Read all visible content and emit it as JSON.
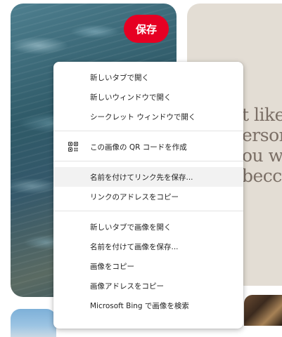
{
  "pin": {
    "save_label": "保存",
    "quote_lines": [
      "t like",
      "ersor",
      "ou wa",
      "becc"
    ]
  },
  "context_menu": {
    "groups": [
      [
        "新しいタブで開く",
        "新しいウィンドウで開く",
        "シークレット ウィンドウで開く"
      ],
      [
        "この画像の QR コードを作成"
      ],
      [
        "名前を付けてリンク先を保存...",
        "リンクのアドレスをコピー"
      ],
      [
        "新しいタブで画像を開く",
        "名前を付けて画像を保存...",
        "画像をコピー",
        "画像アドレスをコピー",
        "Microsoft Bing で画像を検索"
      ]
    ],
    "icons": {
      "qr_item": "qr-code-icon"
    },
    "highlighted_item": "名前を付けてリンク先を保存..."
  },
  "colors": {
    "save_button": "#e60023",
    "hover_background": "#f2f2f2"
  }
}
